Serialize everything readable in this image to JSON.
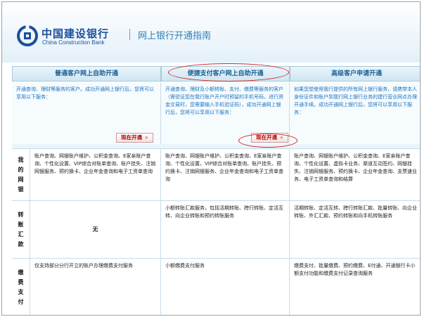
{
  "header": {
    "logo_cn": "中国建设银行",
    "logo_en": "China Construction Bank",
    "title": "网上银行开通指南"
  },
  "columns": [
    {
      "title": "普通客户网上自助开通",
      "intro": "开通查询、理财等服务的客户。成功开通网上银行后，您将可以享用以下服务：",
      "button": "现在开通",
      "rows": [
        "账户查询、网银账户维护、公积金查询、E家亲账户查询、个性化设置、VIP综合对账单查询、账户挂失、注销网银服务、预约换卡、企业年金查询和电子工资单查询",
        "无",
        "仅支持部分分行开立的账户办理缴费支付服务"
      ]
    },
    {
      "title": "便捷支付客户网上自助开通",
      "intro": "开通查询、理财及小额转账、支付、缴费等服务的客户（需验证您在我行账户开户时预留的手机号码，进行资金交易时，您需要输入手机验证码），成功开通网上银行后，您将可以享用以下服务：",
      "button": "现在开通",
      "rows": [
        "账户查询、网银账户维护、公积金查询、E家亲账户查询、个性化设置、VIP综合对账单查询、账户挂失、预约换卡、注销网银服务、企业年金查询和电子工资单查询",
        "小额转账汇款服务，包括活期转账、跨行转账、定活互转、向企业转账和预约转账服务",
        "小额缴费支付服务"
      ]
    },
    {
      "title": "高级客户申请开通",
      "intro": "如果您想使用我行提供的所有网上银行服务，请携带本人身份证件和账户到我行网上银行业务的建行营业网点办理开通手续。成功开通网上银行后，您将可以享用以下服务：",
      "button": "",
      "rows": [
        "账户查询、网银账户维护、公积金查询、E家亲账户查询、个性化设置、虚拟卡业务、渠道互动签约、网银挂失、注销网银服务、预约换卡、企业年金查询、支票速业务、电子工资单查询和结算",
        "活期转账、定活互转、跨行转账汇款、批量转账、向企业转账、外汇汇款、预约转账和向手机转账服务",
        "缴费支付、批量缴费、预约缴费、E付通、开通银行卡小额支付功能和缴费支付记录查询服务"
      ]
    }
  ],
  "row_labels": [
    "我的网银",
    "转账汇款",
    "缴费支付"
  ],
  "colors": {
    "brand": "#1c4f9c",
    "accent": "#2f7fb5",
    "highlight": "#d61f1f"
  }
}
